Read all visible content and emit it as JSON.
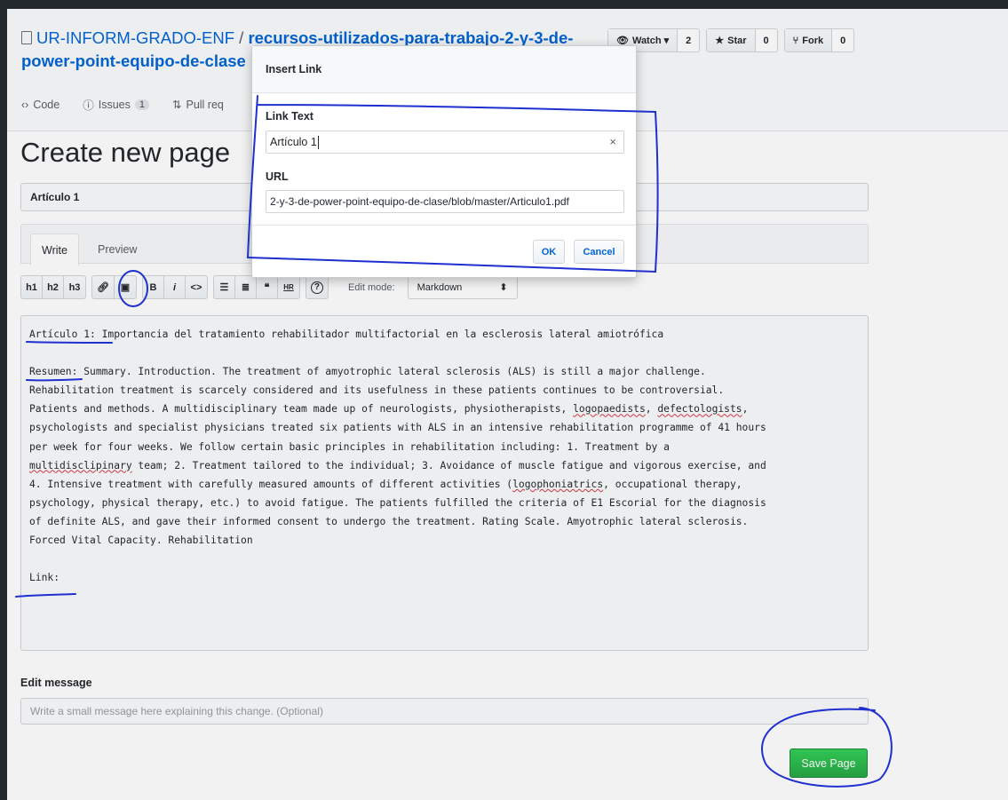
{
  "repo": {
    "owner": "UR-INFORM-GRADO-ENF",
    "separator": "/",
    "name_line1": "recursos-utilizados-para-trabajo-2-y-3-de-",
    "name_line2": "power-point-equipo-de-clase"
  },
  "actions": {
    "watch_label": "Watch ▾",
    "watch_count": "2",
    "star_label": "Star",
    "star_count": "0",
    "fork_label": "Fork",
    "fork_count": "0"
  },
  "tabs": {
    "code": "Code",
    "issues": "Issues",
    "issues_count": "1",
    "pulls": "Pull req"
  },
  "page": {
    "title": "Create new page",
    "page_title_value": "Artículo 1"
  },
  "editor": {
    "write_tab": "Write",
    "preview_tab": "Preview",
    "tools": {
      "h1": "h1",
      "h2": "h2",
      "h3": "h3",
      "bold": "B",
      "italic": "i",
      "code": "<>",
      "quote": "❝",
      "hr": "HR",
      "help": "?"
    },
    "edit_mode_label": "Edit mode:",
    "edit_mode_value": "Markdown",
    "content": {
      "line1_label": "Artículo 1:",
      "line1_text": " Importancia del tratamiento rehabilitador multifactorial en la esclerosis lateral amiotrófica",
      "resumen_label": "Resumen:",
      "resumen_text_a": " Summary. Introduction. The treatment of amyotrophic lateral sclerosis (ALS) is still a major challenge.\nRehabilitation treatment is scarcely considered and its usefulness in these patients continues to be controversial.\nPatients and methods. A multidisciplinary team made up of neurologists, physiotherapists, ",
      "w_logopaedists": "logopaedists",
      "sep_comma": ", ",
      "w_defectologists": "defectologists",
      "resumen_text_b": ",\npsychologists and specialist physicians treated six patients with ALS in an intensive rehabilitation programme of 41 hours\nper week for four weeks. We follow certain basic principles in rehabilitation including: 1. Treatment by a\n",
      "w_multidisclipinary": "multidisclipinary",
      "resumen_text_c": " team; 2. Treatment tailored to the individual; 3. Avoidance of muscle fatigue and vigorous exercise, and\n4. Intensive treatment with carefully measured amounts of different activities (",
      "w_logophoniatrics": "logophoniatrics",
      "resumen_text_d": ", occupational therapy,\npsychology, physical therapy, etc.) to avoid fatigue. The patients fulfilled the criteria of E1 Escorial for the diagnosis\nof definite ALS, and gave their informed consent to undergo the treatment. Rating Scale. Amyotrophic lateral sclerosis.\nForced Vital Capacity. Rehabilitation",
      "link_label": "Link:"
    }
  },
  "edit_message": {
    "label": "Edit message",
    "placeholder": "Write a small message here explaining this change. (Optional)"
  },
  "save_button": "Save Page",
  "modal": {
    "title": "Insert Link",
    "link_text_label": "Link Text",
    "link_text_value": "Artículo 1",
    "url_label": "URL",
    "url_value": "2-y-3-de-power-point-equipo-de-clase/blob/master/Articulo1.pdf",
    "ok_label": "OK",
    "cancel_label": "Cancel",
    "clear_icon": "×"
  },
  "colors": {
    "link_blue": "#0366d6",
    "save_green": "#28a745",
    "annotation_blue": "#1f2fd0"
  }
}
